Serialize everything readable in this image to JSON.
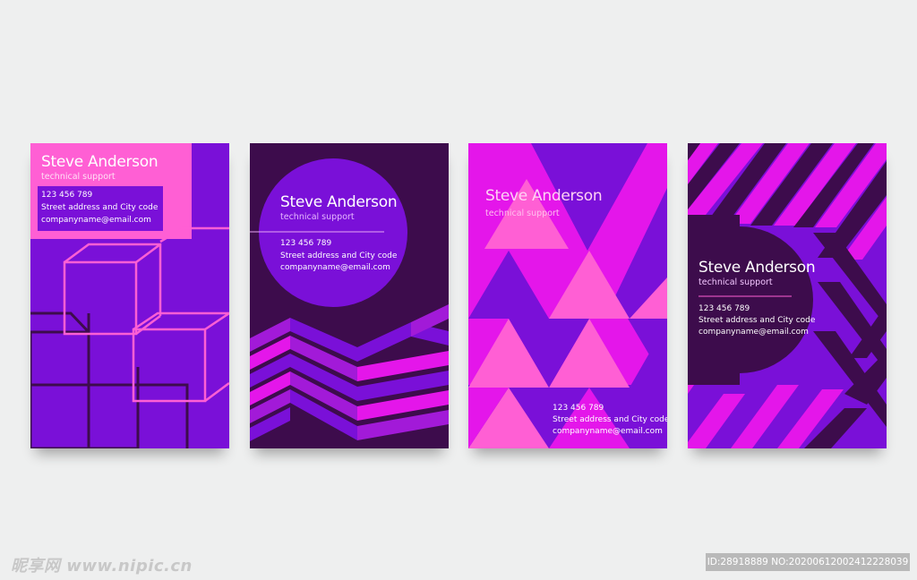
{
  "cards": [
    {
      "name": "Steve Anderson",
      "title": "technical support",
      "phone": "123 456 789",
      "address": "Street address and City code",
      "email": "companyname@email.com"
    },
    {
      "name": "Steve Anderson",
      "title": "technical support",
      "phone": "123 456 789",
      "address": "Street address and City code",
      "email": "companyname@email.com"
    },
    {
      "name": "Steve Anderson",
      "title": "technical support",
      "phone": "123 456 789",
      "address": "Street address and City code",
      "email": "companyname@email.com"
    },
    {
      "name": "Steve Anderson",
      "title": "technical support",
      "phone": "123 456 789",
      "address": "Street address and City code",
      "email": "companyname@email.com"
    }
  ],
  "watermark": {
    "left": "昵享网 www.nipic.cn",
    "right": "ID:28918889 NO:20200612002412228039"
  },
  "colors": {
    "violet": "#7a10d8",
    "deep_purple": "#3d0c4c",
    "magenta": "#e416ea",
    "pink": "#ff5fd4"
  }
}
